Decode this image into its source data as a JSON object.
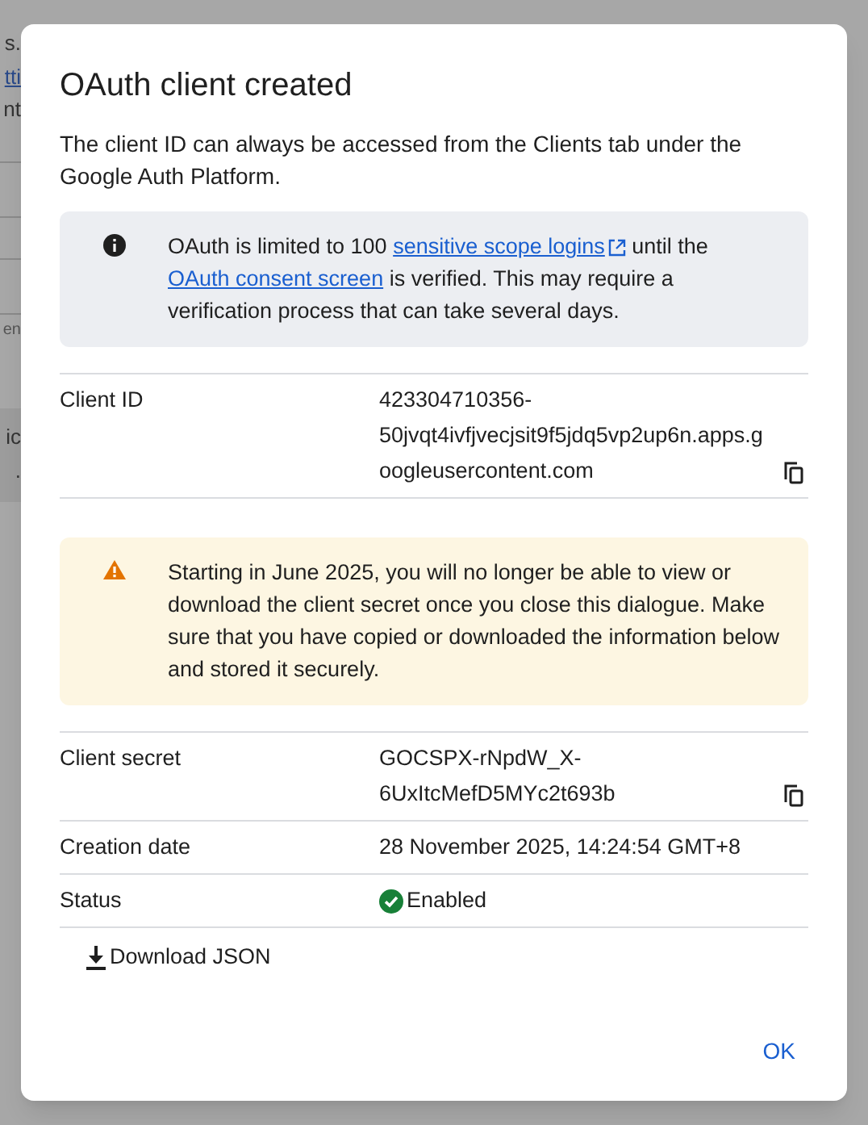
{
  "background": {
    "fragments": [
      {
        "text": "s.",
        "kind": "text"
      },
      {
        "text": "tti",
        "kind": "link"
      },
      {
        "text": "nt",
        "kind": "text"
      },
      {
        "text": "en",
        "kind": "small"
      },
      {
        "text": "ic",
        "kind": "text"
      },
      {
        "text": ".",
        "kind": "text"
      }
    ]
  },
  "dialog": {
    "title": "OAuth client created",
    "intro": "The client ID can always be accessed from the Clients tab under the Google Auth Platform.",
    "info_notice": {
      "kind": "info",
      "segments": [
        {
          "kind": "text",
          "text": "OAuth is limited to 100 "
        },
        {
          "kind": "link",
          "text": "sensitive scope logins",
          "external": true
        },
        {
          "kind": "text",
          "text": " until the "
        },
        {
          "kind": "link",
          "text": "OAuth consent screen",
          "external": false
        },
        {
          "kind": "text",
          "text": " is verified. This may require a verification process that can take several days."
        }
      ]
    },
    "client_id": {
      "label": "Client ID",
      "value": "423304710356-50jvqt4ivfjvecjsit9f5jdq5vp2up6n.apps.googleusercontent.com",
      "copyable": true
    },
    "warning_notice": {
      "kind": "warning",
      "segments": [
        {
          "kind": "text",
          "text": "Starting in June 2025, you will no longer be able to view or download the client secret once you close this dialogue. Make sure that you have copied or downloaded the information below and stored it securely."
        }
      ]
    },
    "details": [
      {
        "kind": "text",
        "label": "Client secret",
        "value": "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",
        "copyable": true
      },
      {
        "kind": "text",
        "label": "Creation date",
        "value": "28 November 2025, 14:24:54 GMT+8",
        "copyable": false
      },
      {
        "kind": "status",
        "label": "Status",
        "value": "Enabled",
        "copyable": false
      }
    ],
    "download_button": "Download JSON",
    "ok_button": "OK"
  }
}
